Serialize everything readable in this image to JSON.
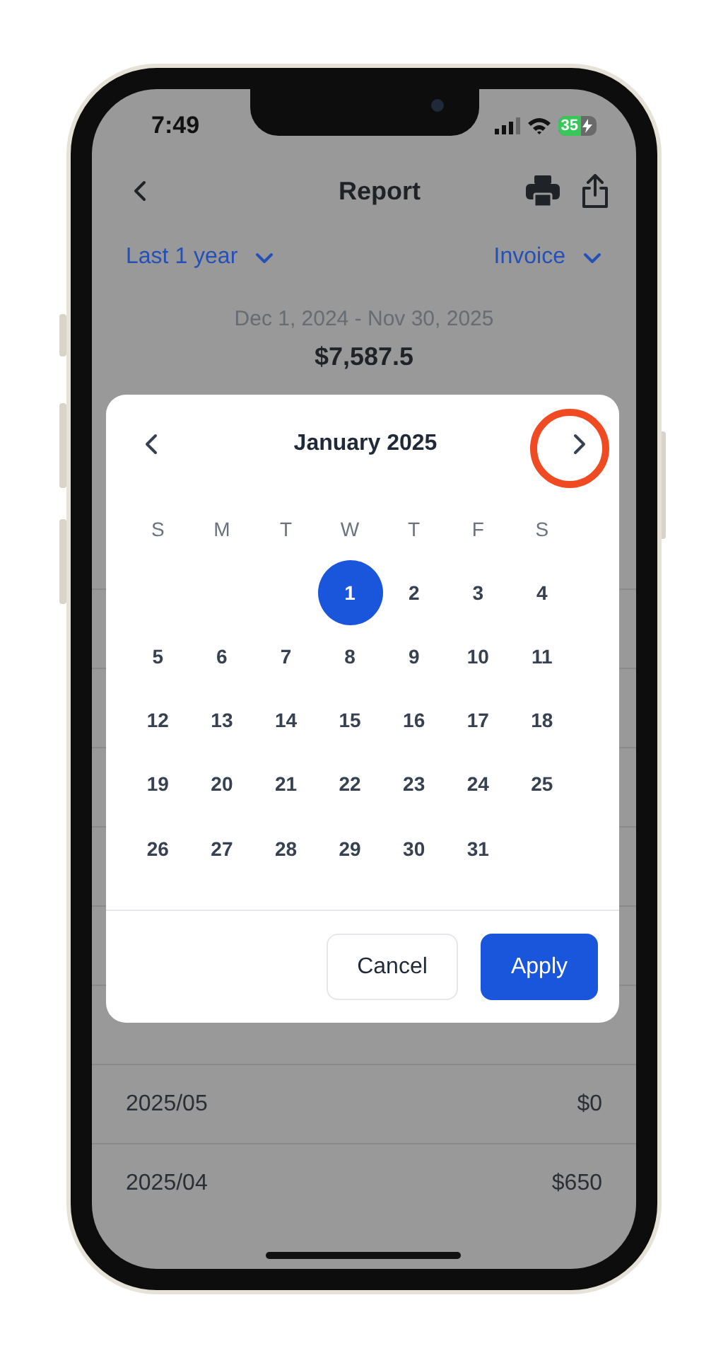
{
  "status_bar": {
    "time": "7:49",
    "battery": "35"
  },
  "nav": {
    "title": "Report"
  },
  "filters": [
    {
      "label": "Last 1 year"
    },
    {
      "label": "Invoice"
    }
  ],
  "summary": {
    "range": "Dec 1, 2024 - Nov 30, 2025",
    "total": "$7,587.5"
  },
  "rows": [
    {
      "month": "2025/05",
      "amount": "$0"
    },
    {
      "month": "2025/04",
      "amount": "$650"
    }
  ],
  "calendar": {
    "month": "January 2025",
    "next_highlighted": true,
    "weekdays": [
      "S",
      "M",
      "T",
      "W",
      "T",
      "F",
      "S"
    ],
    "weeks": [
      {
        "days": [
          {
            "label": "1",
            "selected": true
          },
          {
            "label": "2",
            "selected": false
          },
          {
            "label": "3",
            "selected": false
          },
          {
            "label": "4",
            "selected": false
          }
        ]
      },
      {
        "days": [
          {
            "label": "5",
            "selected": false
          },
          {
            "label": "6",
            "selected": false
          },
          {
            "label": "7",
            "selected": false
          },
          {
            "label": "8",
            "selected": false
          },
          {
            "label": "9",
            "selected": false
          },
          {
            "label": "10",
            "selected": false
          },
          {
            "label": "11",
            "selected": false
          }
        ]
      },
      {
        "days": [
          {
            "label": "12",
            "selected": false
          },
          {
            "label": "13",
            "selected": false
          },
          {
            "label": "14",
            "selected": false
          },
          {
            "label": "15",
            "selected": false
          },
          {
            "label": "16",
            "selected": false
          },
          {
            "label": "17",
            "selected": false
          },
          {
            "label": "18",
            "selected": false
          }
        ]
      },
      {
        "days": [
          {
            "label": "19",
            "selected": false
          },
          {
            "label": "20",
            "selected": false
          },
          {
            "label": "21",
            "selected": false
          },
          {
            "label": "22",
            "selected": false
          },
          {
            "label": "23",
            "selected": false
          },
          {
            "label": "24",
            "selected": false
          },
          {
            "label": "25",
            "selected": false
          }
        ]
      },
      {
        "days": [
          {
            "label": "26",
            "selected": false
          },
          {
            "label": "27",
            "selected": false
          },
          {
            "label": "28",
            "selected": false
          },
          {
            "label": "29",
            "selected": false
          },
          {
            "label": "30",
            "selected": false
          },
          {
            "label": "31",
            "selected": false
          }
        ]
      }
    ],
    "buttons": [
      {
        "label": "Cancel",
        "kind": "secondary"
      },
      {
        "label": "Apply",
        "kind": "primary"
      }
    ]
  }
}
